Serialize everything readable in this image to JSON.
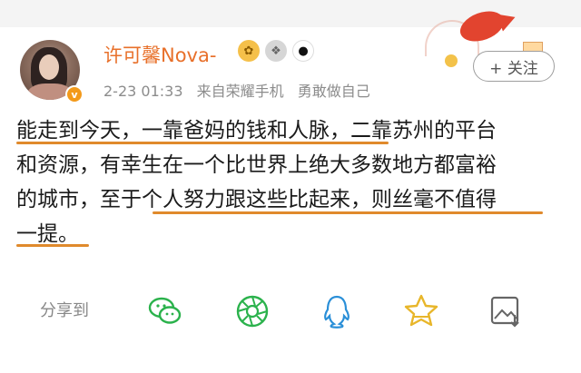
{
  "author": {
    "name": "许可馨Nova-",
    "verified_mark": "v",
    "badges": [
      "gold-badge-icon",
      "silver-badge-icon",
      "panda-icon"
    ]
  },
  "meta": {
    "time": "2-23 01:33",
    "source": "来自荣耀手机",
    "tagline": "勇敢做自己"
  },
  "follow": {
    "label": "+ 关注"
  },
  "post": {
    "lines": [
      "能走到今天，一靠爸妈的钱和人脉，二靠苏州的平台",
      "和资源，有幸生在一个比世界上绝大多数地方都富裕",
      "的城市，至于个人努力跟这些比起来，则丝毫不值得",
      "一提。"
    ]
  },
  "share": {
    "label": "分享到",
    "targets": [
      "wechat-icon",
      "moments-icon",
      "qq-icon",
      "favorite-icon",
      "save-image-icon"
    ]
  },
  "colors": {
    "username": "#e8702a",
    "highlight": "#e08a2c",
    "meta": "#8c8c8c",
    "icon_green": "#2bb24c",
    "icon_blue": "#2a8fd8",
    "icon_yellow": "#e8b62a"
  }
}
